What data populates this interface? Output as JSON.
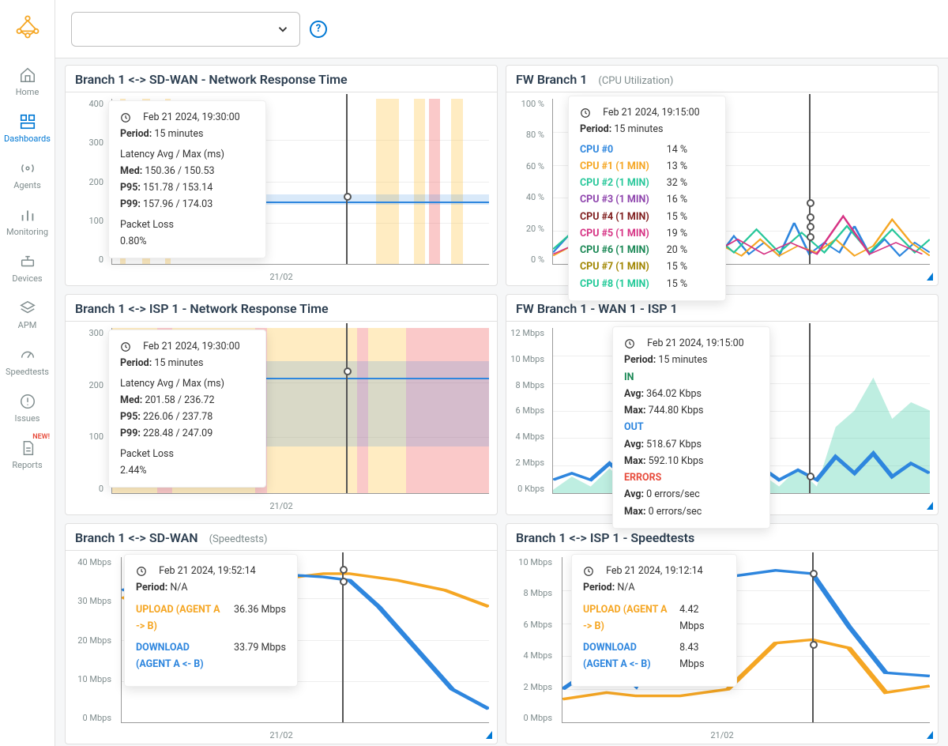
{
  "sidebar": {
    "items": [
      {
        "label": "Home",
        "icon": "home"
      },
      {
        "label": "Dashboards",
        "icon": "grid",
        "active": true
      },
      {
        "label": "Agents",
        "icon": "radio"
      },
      {
        "label": "Monitoring",
        "icon": "bars"
      },
      {
        "label": "Devices",
        "icon": "device"
      },
      {
        "label": "APM",
        "icon": "layers"
      },
      {
        "label": "Speedtests",
        "icon": "gauge"
      },
      {
        "label": "Issues",
        "icon": "alert"
      },
      {
        "label": "Reports",
        "icon": "doc",
        "badge": "NEW!"
      }
    ],
    "badge_text": "NEW!"
  },
  "topbar": {
    "help": "?"
  },
  "panels": [
    {
      "id": "p1",
      "title": "Branch 1 <-> SD-WAN - Network Response Time",
      "x_label": "21/02",
      "tooltip": {
        "time": "Feb 21 2024, 19:30:00",
        "period_label": "Period:",
        "period": "15 minutes",
        "latency_header": "Latency Avg / Max (ms)",
        "stats": [
          {
            "k": "Med:",
            "v": "150.36 / 150.53"
          },
          {
            "k": "P95:",
            "v": "151.78 / 153.14"
          },
          {
            "k": "P99:",
            "v": "157.96 / 174.03"
          }
        ],
        "pl_label": "Packet Loss",
        "pl": "0.80%"
      }
    },
    {
      "id": "p2",
      "title": "FW Branch 1",
      "subtitle": "(CPU Utilization)",
      "x_label": "",
      "tooltip": {
        "time": "Feb 21 2024, 19:15:00",
        "period_label": "Period:",
        "period": "15 minutes",
        "rows": [
          {
            "label": "CPU #0",
            "value": "14 %",
            "color": "#2e86de"
          },
          {
            "label": "CPU #1 (1 MIN)",
            "value": "13 %",
            "color": "#f5a623"
          },
          {
            "label": "CPU #2 (1 MIN)",
            "value": "32 %",
            "color": "#27c79a"
          },
          {
            "label": "CPU #3 (1 MIN)",
            "value": "16 %",
            "color": "#8e44ad"
          },
          {
            "label": "CPU #4 (1 MIN)",
            "value": "15 %",
            "color": "#7f1d1d"
          },
          {
            "label": "CPU #5 (1 MIN)",
            "value": "19 %",
            "color": "#d63384"
          },
          {
            "label": "CPU #6 (1 MIN)",
            "value": "20 %",
            "color": "#198754"
          },
          {
            "label": "CPU #7 (1 MIN)",
            "value": "15 %",
            "color": "#a08500"
          },
          {
            "label": "CPU #8 (1 MIN)",
            "value": "15 %",
            "color": "#20c997"
          }
        ]
      }
    },
    {
      "id": "p3",
      "title": "Branch 1 <-> ISP 1 - Network Response Time",
      "x_label": "21/02",
      "tooltip": {
        "time": "Feb 21 2024, 19:30:00",
        "period_label": "Period:",
        "period": "15 minutes",
        "latency_header": "Latency Avg / Max (ms)",
        "stats": [
          {
            "k": "Med:",
            "v": "201.58 / 236.72"
          },
          {
            "k": "P95:",
            "v": "226.06 / 237.78"
          },
          {
            "k": "P99:",
            "v": "228.48 / 247.09"
          }
        ],
        "pl_label": "Packet Loss",
        "pl": "2.44%"
      }
    },
    {
      "id": "p4",
      "title": "FW Branch 1 - WAN 1 - ISP 1",
      "x_label": "",
      "tooltip": {
        "time": "Feb 21 2024, 19:15:00",
        "period_label": "Period:",
        "period": "15 minutes",
        "groups": [
          {
            "header": "IN",
            "color": "#198754",
            "rows": [
              {
                "k": "Avg:",
                "v": "364.02 Kbps"
              },
              {
                "k": "Max:",
                "v": "744.80 Kbps"
              }
            ]
          },
          {
            "header": "OUT",
            "color": "#2e86de",
            "rows": [
              {
                "k": "Avg:",
                "v": "518.67 Kbps"
              },
              {
                "k": "Max:",
                "v": "592.10 Kbps"
              }
            ]
          },
          {
            "header": "ERRORS",
            "color": "#e74c3c",
            "rows": [
              {
                "k": "Avg:",
                "v": "0 errors/sec"
              },
              {
                "k": "Max:",
                "v": "0 errors/sec"
              }
            ]
          }
        ]
      }
    },
    {
      "id": "p5",
      "title": "Branch 1 <-> SD-WAN",
      "subtitle": "(Speedtests)",
      "x_label": "21/02",
      "tooltip": {
        "time": "Feb 21 2024, 19:52:14",
        "period_label": "Period:",
        "period": "N/A",
        "series": [
          {
            "label": "UPLOAD (AGENT A -> B)",
            "value": "36.36 Mbps",
            "color": "#f5a623"
          },
          {
            "label": "DOWNLOAD (AGENT A <- B)",
            "value": "33.79 Mbps",
            "color": "#2e86de"
          }
        ]
      }
    },
    {
      "id": "p6",
      "title": "Branch 1 <-> ISP 1 - Speedtests",
      "x_label": "21/02",
      "tooltip": {
        "time": "Feb 21 2024, 19:12:14",
        "period_label": "Period:",
        "period": "N/A",
        "series": [
          {
            "label": "UPLOAD (AGENT A -> B)",
            "value": "4.42 Mbps",
            "color": "#f5a623"
          },
          {
            "label": "DOWNLOAD (AGENT A <- B)",
            "value": "8.43 Mbps",
            "color": "#2e86de"
          }
        ]
      }
    }
  ],
  "chart_data": [
    {
      "id": "p1",
      "type": "line",
      "title": "Branch 1 <-> SD-WAN - Network Response Time",
      "ylabel": "",
      "ylim": [
        0,
        400
      ],
      "yticks": [
        0,
        100,
        200,
        300,
        400
      ],
      "x_category_label": "21/02",
      "series": [
        {
          "name": "Med p50",
          "values": [
            150.4
          ],
          "unit": "ms"
        }
      ],
      "packet_loss_pct": 0.8
    },
    {
      "id": "p2",
      "type": "line",
      "title": "FW Branch 1 (CPU Utilization)",
      "ylabel": "%",
      "ylim": [
        0,
        100
      ],
      "yticks_labels": [
        "0 %",
        "20 %",
        "40 %",
        "60 %",
        "80 %",
        "100 %"
      ],
      "series": [
        {
          "name": "CPU #0",
          "value": 14
        },
        {
          "name": "CPU #1 (1 MIN)",
          "value": 13
        },
        {
          "name": "CPU #2 (1 MIN)",
          "value": 32
        },
        {
          "name": "CPU #3 (1 MIN)",
          "value": 16
        },
        {
          "name": "CPU #4 (1 MIN)",
          "value": 15
        },
        {
          "name": "CPU #5 (1 MIN)",
          "value": 19
        },
        {
          "name": "CPU #6 (1 MIN)",
          "value": 20
        },
        {
          "name": "CPU #7 (1 MIN)",
          "value": 15
        },
        {
          "name": "CPU #8 (1 MIN)",
          "value": 15
        }
      ]
    },
    {
      "id": "p3",
      "type": "line",
      "title": "Branch 1 <-> ISP 1 - Network Response Time",
      "ylabel": "",
      "ylim": [
        0,
        300
      ],
      "yticks": [
        0,
        100,
        200,
        300
      ],
      "x_category_label": "21/02",
      "series": [
        {
          "name": "Med p50",
          "values": [
            201.6
          ],
          "unit": "ms"
        }
      ],
      "packet_loss_pct": 2.44
    },
    {
      "id": "p4",
      "type": "area",
      "title": "FW Branch 1 - WAN 1 - ISP 1",
      "ylabel": "",
      "ylim": [
        0,
        12
      ],
      "yticks_labels": [
        "0 Kbps",
        "2 Mbps",
        "4 Mbps",
        "6 Mbps",
        "8 Mbps",
        "10 Mbps",
        "12 Mbps"
      ],
      "series": [
        {
          "name": "IN avg",
          "value": 364.02,
          "unit": "Kbps"
        },
        {
          "name": "IN max",
          "value": 744.8,
          "unit": "Kbps"
        },
        {
          "name": "OUT avg",
          "value": 518.67,
          "unit": "Kbps"
        },
        {
          "name": "OUT max",
          "value": 592.1,
          "unit": "Kbps"
        },
        {
          "name": "Errors avg",
          "value": 0,
          "unit": "errors/sec"
        },
        {
          "name": "Errors max",
          "value": 0,
          "unit": "errors/sec"
        }
      ]
    },
    {
      "id": "p5",
      "type": "line",
      "title": "Branch 1 <-> SD-WAN (Speedtests)",
      "ylabel": "Mbps",
      "ylim": [
        0,
        40
      ],
      "yticks_labels": [
        "0 Mbps",
        "10 Mbps",
        "20 Mbps",
        "30 Mbps",
        "40 Mbps"
      ],
      "x_category_label": "21/02",
      "series": [
        {
          "name": "UPLOAD (AGENT A -> B)",
          "value": 36.36
        },
        {
          "name": "DOWNLOAD (AGENT A <- B)",
          "value": 33.79
        }
      ]
    },
    {
      "id": "p6",
      "type": "line",
      "title": "Branch 1 <-> ISP 1 - Speedtests",
      "ylabel": "Mbps",
      "ylim": [
        0,
        10
      ],
      "yticks_labels": [
        "0 Mbps",
        "2 Mbps",
        "4 Mbps",
        "6 Mbps",
        "8 Mbps",
        "10 Mbps"
      ],
      "x_category_label": "21/02",
      "series": [
        {
          "name": "UPLOAD (AGENT A -> B)",
          "value": 4.42
        },
        {
          "name": "DOWNLOAD (AGENT A <- B)",
          "value": 8.43
        }
      ]
    }
  ]
}
